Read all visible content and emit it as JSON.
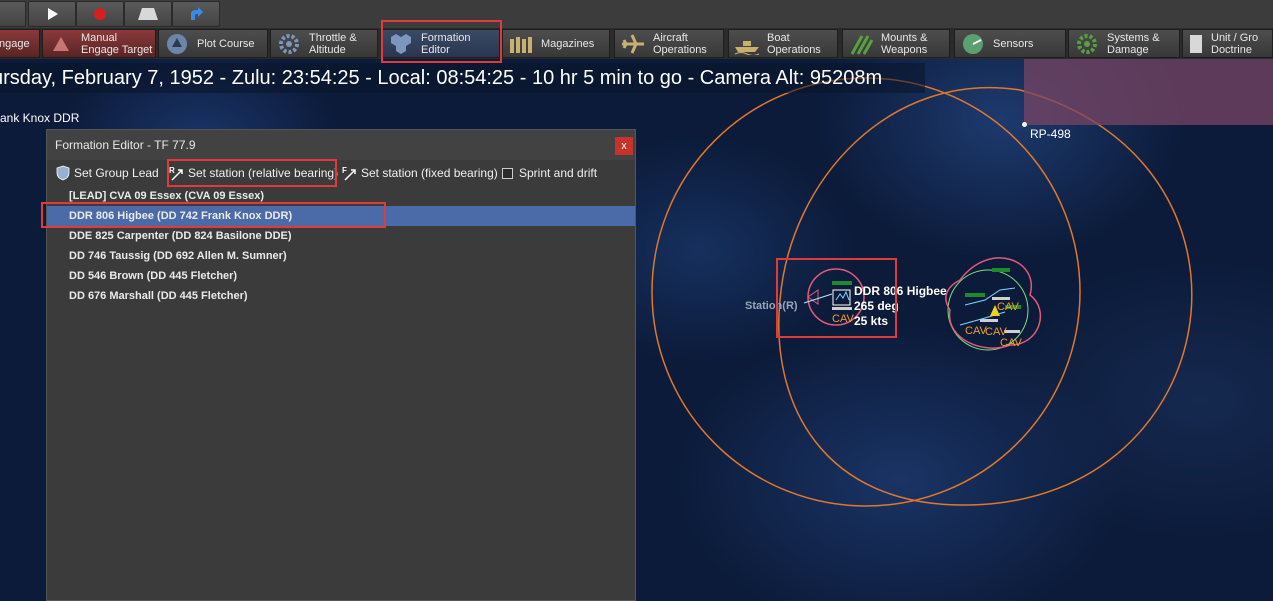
{
  "toolbar": {
    "buttons": [
      {
        "name": "unknown-tool-icon"
      },
      {
        "name": "play-icon"
      },
      {
        "name": "record-icon"
      },
      {
        "name": "runway-icon"
      },
      {
        "name": "jump-arrow-icon"
      }
    ]
  },
  "tabs": [
    {
      "label": "ngage",
      "icon": "engage-icon",
      "style": "red"
    },
    {
      "label": "Manual\nEngage Target",
      "icon": "manual-engage-icon",
      "style": "red"
    },
    {
      "label": "Plot Course",
      "icon": "plot-course-icon"
    },
    {
      "label": "Throttle &\nAltitude",
      "icon": "gears-icon"
    },
    {
      "label": "Formation\nEditor",
      "icon": "formation-icon",
      "style": "active"
    },
    {
      "label": "Magazines",
      "icon": "magazines-icon"
    },
    {
      "label": "Aircraft\nOperations",
      "icon": "aircraft-icon"
    },
    {
      "label": "Boat\nOperations",
      "icon": "boat-icon"
    },
    {
      "label": "Mounts &\nWeapons",
      "icon": "weapons-icon"
    },
    {
      "label": "Sensors",
      "icon": "sensors-icon"
    },
    {
      "label": "Systems &\nDamage",
      "icon": "systems-gear-icon"
    },
    {
      "label": "Unit / Gro\nDoctrine",
      "icon": "doctrine-icon"
    }
  ],
  "status": {
    "line": "ursday, February 7, 1952 - Zulu: 23:54:25 - Local: 08:54:25 - 10 hr 5 min to go -  Camera Alt: 95208m"
  },
  "unit_label": "ank Knox DDR",
  "map": {
    "reference_point": "RP-498",
    "station_label": "Station(R)",
    "selected_unit": {
      "name": "DDR 806 Higbee",
      "bearing": "265 deg",
      "speed": "25 kts",
      "tag": "CAV"
    },
    "group_tags": [
      "CAV",
      "CAV",
      "CAV",
      "CAV"
    ],
    "colors": {
      "range_ring": "#e0782a",
      "unit_ring": "#e05a7a",
      "highlight": "#e03a3a"
    }
  },
  "formation_editor": {
    "title": "Formation Editor - TF 77.9",
    "close_label": "x",
    "tools": {
      "set_group_lead": "Set Group Lead",
      "set_station_relative": "Set station (relative bearing)",
      "set_station_fixed": "Set station (fixed bearing)",
      "sprint_and_drift": "Sprint and drift"
    },
    "ships": [
      "[LEAD] CVA 09 Essex (CVA 09 Essex)",
      "DDR 806 Higbee (DD 742 Frank Knox DDR)",
      "DDE 825 Carpenter (DD 824 Basilone DDE)",
      "DD 746 Taussig (DD 692 Allen M. Sumner)",
      "DD 546 Brown (DD 445 Fletcher)",
      "DD 676 Marshall (DD 445 Fletcher)"
    ],
    "selected_index": 1
  }
}
